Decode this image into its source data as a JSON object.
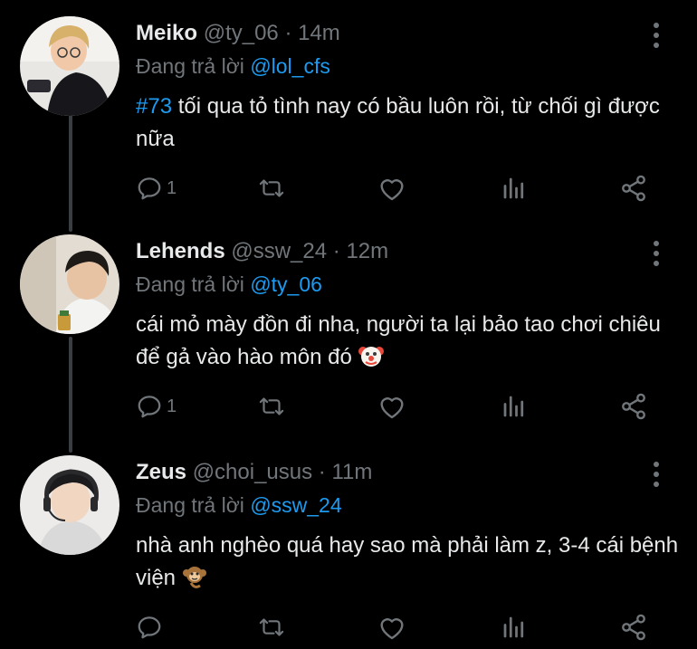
{
  "colors": {
    "background": "#000000",
    "text": "#e7e9ea",
    "muted": "#71767b",
    "link": "#1d9bf0",
    "thread_line": "#3a3d41"
  },
  "tweets": [
    {
      "name": "Meiko",
      "handle": "@ty_06",
      "time": "· 14m",
      "replying_prefix": "Đang trả lời",
      "replying_to": "@lol_cfs",
      "hashtag": "#73",
      "text": " tối qua tỏ tình nay có bầu luôn rồi, từ chối gì được nữa",
      "reply_count": "1",
      "icons": [
        "reply-icon",
        "retweet-icon",
        "like-icon",
        "analytics-icon",
        "share-icon"
      ]
    },
    {
      "name": "Lehends",
      "handle": "@ssw_24",
      "time": "· 12m",
      "replying_prefix": "Đang trả lời",
      "replying_to": "@ty_06",
      "text": "cái mỏ mày đồn đi nha, người ta lại bảo tao chơi chiêu để gả vào hào môn đó",
      "emoji": "clown-face-emoji",
      "reply_count": "1",
      "icons": [
        "reply-icon",
        "retweet-icon",
        "like-icon",
        "analytics-icon",
        "share-icon"
      ]
    },
    {
      "name": "Zeus",
      "handle": "@choi_usus",
      "time": "· 11m",
      "replying_prefix": "Đang trả lời",
      "replying_to": "@ssw_24",
      "text": "nhà anh nghèo quá hay sao mà phải làm z, 3-4 cái bệnh viện",
      "emoji": "monkey-emoji",
      "reply_count": "",
      "icons": [
        "reply-icon",
        "retweet-icon",
        "like-icon",
        "analytics-icon",
        "share-icon"
      ]
    }
  ]
}
